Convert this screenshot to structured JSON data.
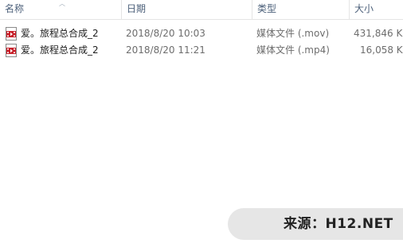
{
  "columns": {
    "name": "名称",
    "date": "日期",
    "type": "类型",
    "size": "大小"
  },
  "files": [
    {
      "name": "爱。旅程总合成_2",
      "date": "2018/8/20 10:03",
      "type": "媒体文件 (.mov)",
      "size": "431,846 K",
      "icon": "video-file-icon"
    },
    {
      "name": "爱。旅程总合成_2",
      "date": "2018/8/20 11:21",
      "type": "媒体文件 (.mp4)",
      "size": "16,058 K",
      "icon": "video-file-icon"
    }
  ],
  "watermark": "来源：H12.NET",
  "colors": {
    "header_text": "#4c607a",
    "icon_red": "#c8202a"
  }
}
